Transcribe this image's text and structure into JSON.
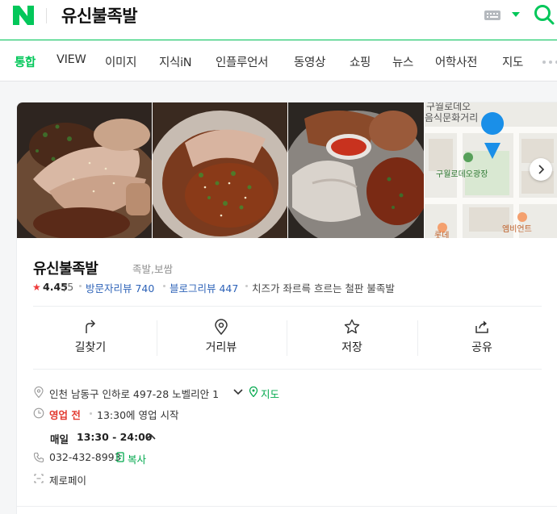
{
  "header": {
    "search_value": "유신불족발"
  },
  "tabs": [
    "통합",
    "VIEW",
    "이미지",
    "지식iN",
    "인플루언서",
    "동영상",
    "쇼핑",
    "뉴스",
    "어학사전",
    "지도"
  ],
  "map": {
    "labels": [
      "구월로데오",
      "음식문화거리",
      "구월로데오광장",
      "엠비언트",
      "롯데"
    ]
  },
  "place": {
    "name": "유신불족발",
    "category": "족발,보쌈",
    "rating": "4.45",
    "rating_max": "/5",
    "visitor_reviews": "방문자리뷰 740",
    "blog_reviews": "블로그리뷰 447",
    "description": "치즈가 좌르륵 흐르는 철판 불족발"
  },
  "actions": {
    "directions": "길찾기",
    "street_view": "거리뷰",
    "save": "저장",
    "share": "공유"
  },
  "info": {
    "address": "인천 남동구 인하로 497-28 노벨리안 1",
    "map_link": "지도",
    "status": "영업 전",
    "status_detail": "13:30에 영업 시작",
    "hours_day": "매일",
    "hours_time": "13:30 - 24:00",
    "phone": "032-432-8993",
    "copy": "복사",
    "payment": "제로페이"
  },
  "colors": {
    "brand_green": "#03c75a",
    "link_blue": "#2e63b8",
    "status_red": "#e2392f",
    "star_red": "#ee3a3a"
  }
}
